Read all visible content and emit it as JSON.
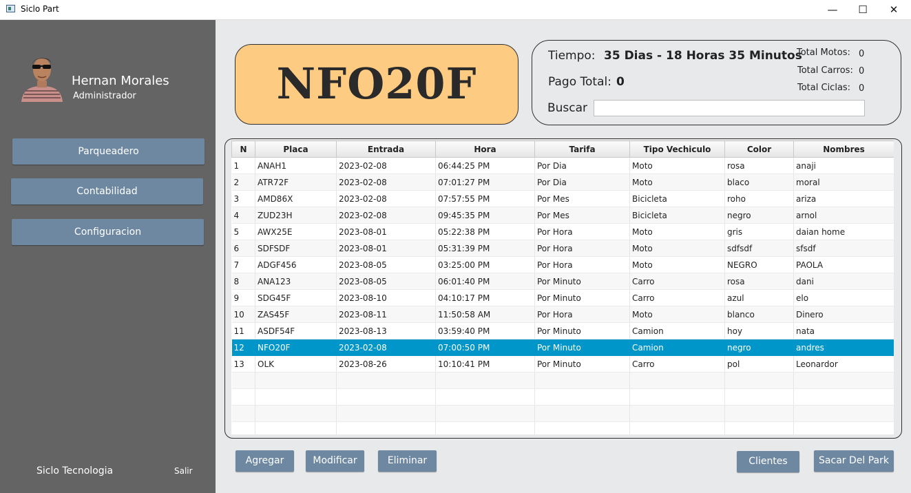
{
  "window": {
    "title": "Siclo Part",
    "minimize": "—",
    "maximize": "☐",
    "close": "✕"
  },
  "sidebar": {
    "user_name": "Hernan Morales",
    "user_role": "Administrador",
    "nav": [
      "Parqueadero",
      "Contabilidad",
      "Configuracion"
    ],
    "brand": "Siclo Tecnologia",
    "exit": "Salir"
  },
  "plate": {
    "text": "NFO20F",
    "color": "#fecb82"
  },
  "info": {
    "tiempo_label": "Tiempo:",
    "tiempo_value": "35 Dias - 18 Horas 35 Minutos",
    "pago_label": "Pago Total:",
    "pago_value": "0",
    "buscar_label": "Buscar",
    "buscar_value": "",
    "motos_label": "Total Motos:",
    "motos_value": "0",
    "carros_label": "Total Carros:",
    "carros_value": "0",
    "ciclas_label": "Total Ciclas:",
    "ciclas_value": "0"
  },
  "table": {
    "headers": [
      "N",
      "Placa",
      "Entrada",
      "Hora",
      "Tarifa",
      "Tipo Vechiculo",
      "Color",
      "Nombres"
    ],
    "rows": [
      [
        "1",
        "ANAH1",
        "2023-02-08",
        "06:44:25 PM",
        "Por Dia",
        "Moto",
        "rosa",
        "anaji"
      ],
      [
        "2",
        "ATR72F",
        "2023-02-08",
        "07:01:27 PM",
        "Por Dia",
        "Moto",
        "blaco",
        "moral"
      ],
      [
        "3",
        "AMD86X",
        "2023-02-08",
        "07:57:55 PM",
        "Por Mes",
        "Bicicleta",
        "roho",
        "ariza"
      ],
      [
        "4",
        "ZUD23H",
        "2023-02-08",
        "09:45:35 PM",
        "Por Mes",
        "Bicicleta",
        "negro",
        "arnol"
      ],
      [
        "5",
        "AWX25E",
        "2023-08-01",
        "05:22:38 PM",
        "Por Hora",
        "Moto",
        "gris",
        "daian home"
      ],
      [
        "6",
        "SDFSDF",
        "2023-08-01",
        "05:31:39 PM",
        "Por Hora",
        "Moto",
        "sdfsdf",
        "sfsdf"
      ],
      [
        "7",
        "ADGF456",
        "2023-08-05",
        "03:25:00 PM",
        "Por Hora",
        "Moto",
        "NEGRO",
        "PAOLA"
      ],
      [
        "8",
        "ANA123",
        "2023-08-05",
        "06:01:40 PM",
        "Por Minuto",
        "Carro",
        "rosa",
        "dani"
      ],
      [
        "9",
        "SDG45F",
        "2023-08-10",
        "04:10:17 PM",
        "Por Minuto",
        "Carro",
        "azul",
        "elo"
      ],
      [
        "10",
        "ZAS45F",
        "2023-08-11",
        "11:50:58 AM",
        "Por Hora",
        "Moto",
        "blanco",
        "Dinero"
      ],
      [
        "11",
        "ASDF54F",
        "2023-08-13",
        "03:59:40 PM",
        "Por Minuto",
        "Camion",
        "hoy",
        "nata"
      ],
      [
        "12",
        "NFO20F",
        "2023-02-08",
        "07:00:50 PM",
        "Por Minuto",
        "Camion",
        "negro",
        "andres"
      ],
      [
        "13",
        "OLK",
        "2023-08-26",
        "10:10:41 PM",
        "Por Minuto",
        "Carro",
        "pol",
        "Leonardor"
      ]
    ],
    "selected_row": 12,
    "selection_color": "#0096c9"
  },
  "actions": {
    "agregar": "Agregar",
    "modificar": "Modificar",
    "eliminar": "Eliminar",
    "clientes": "Clientes",
    "sacar": "Sacar Del Park"
  },
  "colors": {
    "sidebar": "#646464",
    "button": "#6e88a2",
    "background": "#e7e9eb"
  }
}
